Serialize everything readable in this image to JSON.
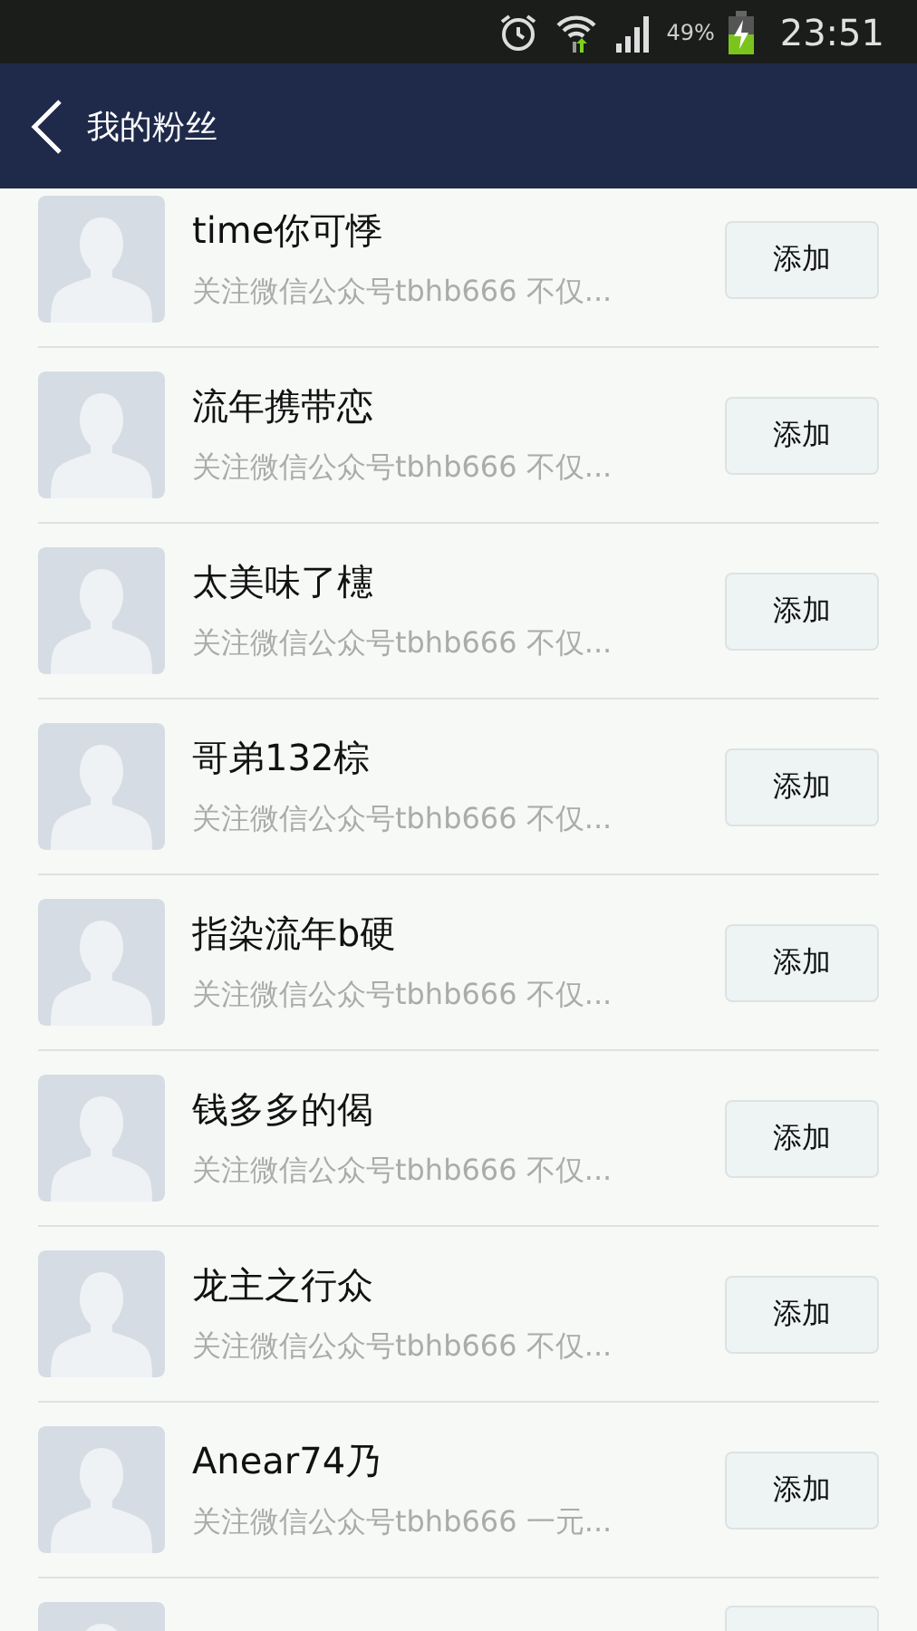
{
  "status_bar": {
    "battery_percent": "49%",
    "time": "23:51"
  },
  "header": {
    "title": "我的粉丝"
  },
  "fans": [
    {
      "kind": "full",
      "name": "time你可悸",
      "subtitle": "关注微信公众号tbhb666 不仅...",
      "button": "添加"
    },
    {
      "kind": "full",
      "name": "流年携带恋",
      "subtitle": "关注微信公众号tbhb666 不仅...",
      "button": "添加"
    },
    {
      "kind": "full",
      "name": "太美味了櫶",
      "subtitle": "关注微信公众号tbhb666 不仅...",
      "button": "添加"
    },
    {
      "kind": "full",
      "name": "哥弟132棕",
      "subtitle": "关注微信公众号tbhb666 不仅...",
      "button": "添加"
    },
    {
      "kind": "full",
      "name": "指染流年b硬",
      "subtitle": "关注微信公众号tbhb666 不仅...",
      "button": "添加"
    },
    {
      "kind": "full",
      "name": "钱多多的偈",
      "subtitle": "关注微信公众号tbhb666 不仅...",
      "button": "添加"
    },
    {
      "kind": "full",
      "name": "龙主之行众",
      "subtitle": "关注微信公众号tbhb666 不仅...",
      "button": "添加"
    },
    {
      "kind": "full",
      "name": "Anear74乃",
      "subtitle": "关注微信公众号tbhb666 一元...",
      "button": "添加"
    },
    {
      "kind": "partial"
    }
  ]
}
